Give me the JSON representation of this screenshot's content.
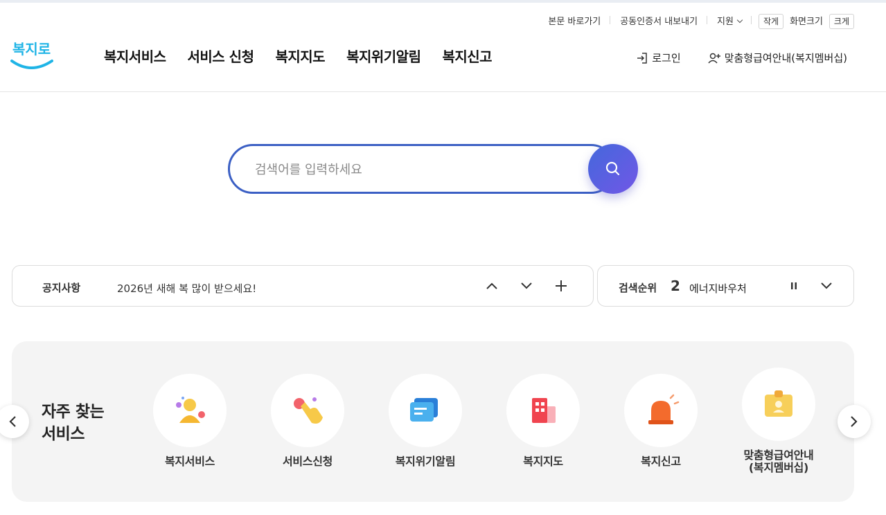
{
  "utility": {
    "skip_to_content": "본문 바로가기",
    "export_cert": "공동인증서 내보내기",
    "support": "지원",
    "zoom_small": "작게",
    "zoom_label": "화면크기",
    "zoom_large": "크게"
  },
  "logo": {
    "text": "복지로"
  },
  "nav": {
    "items": [
      {
        "label": "복지서비스"
      },
      {
        "label": "서비스 신청"
      },
      {
        "label": "복지지도"
      },
      {
        "label": "복지위기알림"
      },
      {
        "label": "복지신고"
      }
    ]
  },
  "header_right": {
    "login": "로그인",
    "membership": "맞춤형급여안내(복지멤버십)"
  },
  "search": {
    "placeholder": "검색어를 입력하세요",
    "value": ""
  },
  "notice": {
    "title": "공지사항",
    "text": "2026년 새해 복 많이 받으세요!"
  },
  "rank": {
    "title": "검색순위",
    "number": "2",
    "keyword": "에너지바우처"
  },
  "frequent": {
    "title_line1": "자주 찾는",
    "title_line2": "서비스",
    "services": [
      {
        "label": "복지서비스",
        "icon": "person-icon"
      },
      {
        "label": "서비스신청",
        "icon": "hand-tap-icon"
      },
      {
        "label": "복지위기알림",
        "icon": "message-icon"
      },
      {
        "label": "복지지도",
        "icon": "building-icon"
      },
      {
        "label": "복지신고",
        "icon": "siren-icon"
      },
      {
        "label_line1": "맞춤형급여안내",
        "label_line2": "(복지멤버십)",
        "icon": "id-card-icon"
      }
    ]
  },
  "colors": {
    "brand_blue": "#3b5fc4",
    "search_btn_start": "#4468dc",
    "search_btn_end": "#7157e6",
    "panel_bg": "#f4f4f4",
    "logo_cyan": "#1fb4e6"
  }
}
